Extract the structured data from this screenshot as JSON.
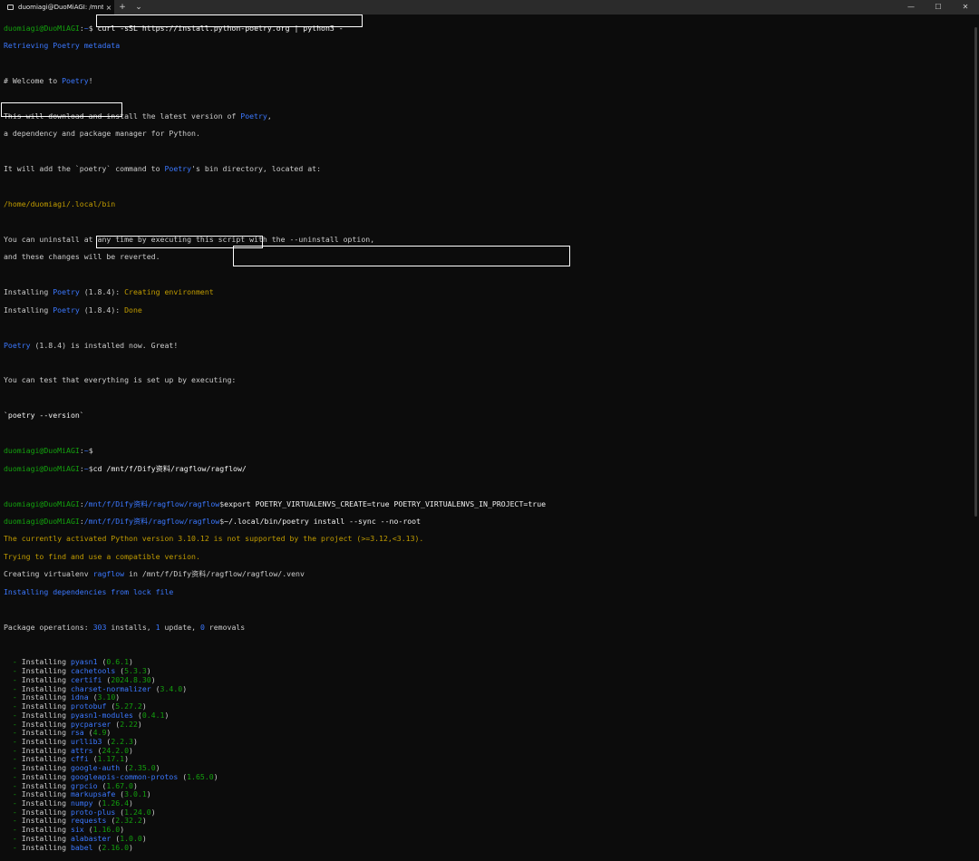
{
  "window": {
    "tab_title": "duomiagi@DuoMiAGI: /mnt/f/",
    "tab_close": "×",
    "new_tab": "+",
    "dropdown": "⌄",
    "minimize": "—",
    "maximize": "☐",
    "close": "✕"
  },
  "prompt": {
    "user": "duomiagi@DuoMiAGI",
    "colon": ":",
    "home": "~",
    "dollar": "$",
    "ragflow_path": "/mnt/f/Dify资料/ragflow/ragflow"
  },
  "lines": {
    "curl_cmd": " curl -sSL https://install.python-poetry.org | python3 -",
    "retrieving": "Retrieving Poetry metadata",
    "welcome_pre": "# Welcome to ",
    "poetry": "Poetry",
    "bang": "!",
    "this_will_pre": "This will download and install the latest version of ",
    "comma": ",",
    "dep_manager": "a dependency and package manager for Python.",
    "add_pre": "It will add the `poetry` command to ",
    "add_post": "'s bin directory, located at:",
    "bin_path": "/home/duomiagi/.local/bin",
    "uninstall1": "You can uninstall at any time by executing this script with the --uninstall option,",
    "uninstall2": "and these changes will be reverted.",
    "installing_pre": "Installing ",
    "version_paren": " (1.8.4): ",
    "creating_env": "Creating environment",
    "done": "Done",
    "installed_now": " (1.8.4) is installed now. Great!",
    "test_line": "You can test that everything is set up by executing:",
    "version_cmd": "`poetry --version`",
    "cd_cmd": "cd /mnt/f/Dify资料/ragflow/ragflow/",
    "export_cmd": "export POETRY_VIRTUALENVS_CREATE=true POETRY_VIRTUALENVS_IN_PROJECT=true",
    "poetry_install_cmd": "~/.local/bin/poetry install --sync --no-root",
    "not_supported": "The currently activated Python version 3.10.12 is not supported by the project (>=3.12,<3.13).",
    "trying": "Trying to find and use a compatible version.",
    "creating_venv_pre": "Creating virtualenv ",
    "ragflow": "ragflow",
    "creating_venv_post": " in /mnt/f/Dify资料/ragflow/ragflow/.venv",
    "installing_deps": "Installing dependencies from lock file",
    "pkg_ops_pre": "Package operations: ",
    "pkg_ops_n1": "303",
    "pkg_ops_mid1": " installs, ",
    "pkg_ops_n2": "1",
    "pkg_ops_mid2": " update, ",
    "pkg_ops_n3": "0",
    "pkg_ops_post": " removals",
    "dash": "  - ",
    "installing_word": "Installing "
  },
  "packages": [
    {
      "name": "pyasn1",
      "version": "0.6.1"
    },
    {
      "name": "cachetools",
      "version": "5.3.3"
    },
    {
      "name": "certifi",
      "version": "2024.8.30"
    },
    {
      "name": "charset-normalizer",
      "version": "3.4.0"
    },
    {
      "name": "idna",
      "version": "3.10"
    },
    {
      "name": "protobuf",
      "version": "5.27.2"
    },
    {
      "name": "pyasn1-modules",
      "version": "0.4.1"
    },
    {
      "name": "pycparser",
      "version": "2.22"
    },
    {
      "name": "rsa",
      "version": "4.9"
    },
    {
      "name": "urllib3",
      "version": "2.2.3"
    },
    {
      "name": "attrs",
      "version": "24.2.0"
    },
    {
      "name": "cffi",
      "version": "1.17.1"
    },
    {
      "name": "google-auth",
      "version": "2.35.0"
    },
    {
      "name": "googleapis-common-protos",
      "version": "1.65.0"
    },
    {
      "name": "grpcio",
      "version": "1.67.0"
    },
    {
      "name": "markupsafe",
      "version": "3.0.1"
    },
    {
      "name": "numpy",
      "version": "1.26.4"
    },
    {
      "name": "proto-plus",
      "version": "1.24.0"
    },
    {
      "name": "requests",
      "version": "2.32.2"
    },
    {
      "name": "six",
      "version": "1.16.0"
    },
    {
      "name": "alabaster",
      "version": "1.0.0"
    },
    {
      "name": "babel",
      "version": "2.16.0"
    }
  ],
  "colors": {
    "background": "#0c0c0c",
    "prompt_green": "#13a10e",
    "path_blue": "#3b78ff",
    "warning_yellow": "#c19c00",
    "highlight_box": "#ffffff"
  }
}
